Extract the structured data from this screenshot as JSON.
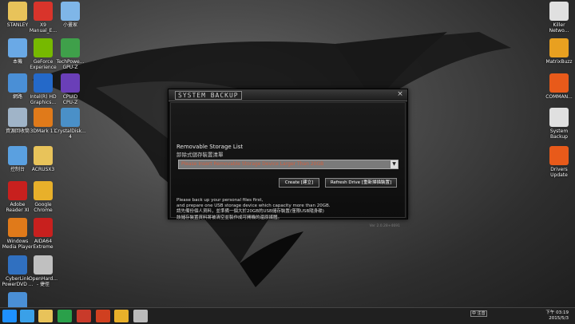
{
  "desktop_icons_left": [
    {
      "label": "STANLEY",
      "icon": "user-folder-icon",
      "color": "#e8c35a"
    },
    {
      "label": "X9\nManual_E...",
      "icon": "pdf-icon",
      "color": "#d9342b"
    },
    {
      "label": "小畫家",
      "icon": "paint-icon",
      "color": "#7fb6e8"
    },
    {
      "label": "本機",
      "icon": "computer-icon",
      "color": "#6aa9e6"
    },
    {
      "label": "GeForce\nExperience",
      "icon": "geforce-icon",
      "color": "#76b900"
    },
    {
      "label": "TechPowe...\nGPU-Z",
      "icon": "gpuz-icon",
      "color": "#3fa04a"
    },
    {
      "label": "網路",
      "icon": "network-icon",
      "color": "#4a8fd6"
    },
    {
      "label": "Intel(R) HD\nGraphics...",
      "icon": "intel-icon",
      "color": "#2469c9"
    },
    {
      "label": "CPUID\nCPU-Z",
      "icon": "cpuz-icon",
      "color": "#6a3fb8"
    },
    {
      "label": "資源回收筒",
      "icon": "recycle-bin-icon",
      "color": "#a0b4c8"
    },
    {
      "label": "3DMark 11",
      "icon": "3dmark-icon",
      "color": "#e07a1a"
    },
    {
      "label": "CrystalDisk...\n4",
      "icon": "crystaldisk-icon",
      "color": "#4a90c8"
    },
    {
      "label": "控制台",
      "icon": "control-panel-icon",
      "color": "#5aa0e0"
    },
    {
      "label": "ACRUSX3",
      "icon": "folder-icon",
      "color": "#e8c35a"
    },
    {
      "label": "Adobe\nReader XI",
      "icon": "adobe-reader-icon",
      "color": "#c8201e"
    },
    {
      "label": "Google\nChrome",
      "icon": "chrome-icon",
      "color": "#e8b02a"
    },
    {
      "label": "Windows\nMedia Player",
      "icon": "media-player-icon",
      "color": "#e07a1a"
    },
    {
      "label": "AIDA64\nExtreme",
      "icon": "aida64-icon",
      "color": "#c8201e"
    },
    {
      "label": "CyberLink\nPowerDVD ...",
      "icon": "powerdvd-icon",
      "color": "#3070c0"
    },
    {
      "label": "OpenHard...\n- 捷徑",
      "icon": "openhardware-icon",
      "color": "#c0c0c0"
    },
    {
      "label": "",
      "icon": "network-drive-icon",
      "color": "#4a8fd6"
    }
  ],
  "desktop_icons_right": [
    {
      "label": "Killer\nNetwo...",
      "icon": "killer-icon",
      "color": "#e0e0e0"
    },
    {
      "label": "MatrixBuzz",
      "icon": "matrixbuzz-icon",
      "color": "#e8a020"
    },
    {
      "label": "COMMAN...",
      "icon": "command-center-icon",
      "color": "#e85a1a"
    },
    {
      "label": "System\nBackup",
      "icon": "system-backup-icon",
      "color": "#e0e0e0"
    },
    {
      "label": "Drivers\nUpdate",
      "icon": "drivers-update-icon",
      "color": "#e85a1a"
    }
  ],
  "dialog": {
    "title": "SYSTEM BACKUP",
    "close": "×",
    "heading_en": "Removable Storage List",
    "heading_zh": "卸除式儲存裝置清單",
    "select_value": "Please Insert Removable Storage Device Larger Than 20GB",
    "create_button": "Create [建立]",
    "refresh_button": "Refresh Drive [重新掃描裝置]",
    "info_lines": [
      "Please back up your personal files first,",
      "and prepare one USB storage device which capacity more than 20GB.",
      "請先備份個人資料，並準備一個大於20GB的USB儲存裝置(僅限USB隨身碟)",
      "該儲存裝置資料將被清空並製作成可開機的還原媒體。"
    ],
    "version": "Ver 2.0.28+4691"
  },
  "taskbar": {
    "ime": "中 注音",
    "time": "下午 03:19",
    "date": "2015/5/3",
    "pinned": [
      {
        "icon": "start-icon",
        "color": "#1e90ff"
      },
      {
        "icon": "ie-icon",
        "color": "#3aa0e8"
      },
      {
        "icon": "explorer-icon",
        "color": "#e8c35a"
      },
      {
        "icon": "store-icon",
        "color": "#2aa04a"
      },
      {
        "icon": "app-icon",
        "color": "#c83a2a"
      },
      {
        "icon": "app2-icon",
        "color": "#d04020"
      },
      {
        "icon": "chrome-icon",
        "color": "#e8b02a"
      },
      {
        "icon": "backup-app-icon",
        "color": "#bbbbbb"
      }
    ]
  }
}
